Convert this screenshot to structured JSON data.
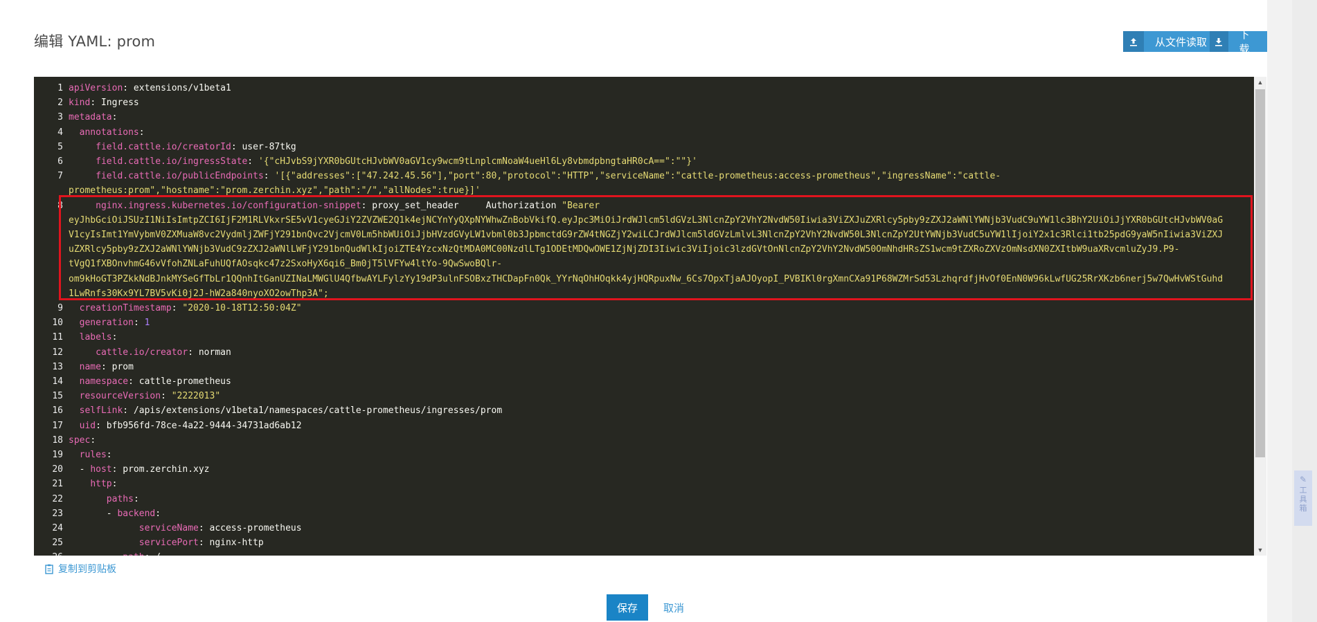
{
  "dialog": {
    "title": "编辑 YAML: prom",
    "read_from_file": "从文件读取",
    "download": "下载",
    "copy_to_clipboard": "复制到剪贴板",
    "save": "保存",
    "cancel": "取消"
  },
  "floating_tab": {
    "label": "工具箱"
  },
  "lines": [
    {
      "n": "1",
      "html": "<span class=\"k\">apiVersion</span>: extensions/v1beta1"
    },
    {
      "n": "2",
      "html": "<span class=\"k\">kind</span>: Ingress"
    },
    {
      "n": "3",
      "html": "<span class=\"k\">metadata</span>:"
    },
    {
      "n": "4",
      "html": "  <span class=\"k\">annotations</span>:"
    },
    {
      "n": "5",
      "html": "     <span class=\"k\">field.cattle.io/creatorId</span>: user-87tkg"
    },
    {
      "n": "6",
      "html": "     <span class=\"k\">field.cattle.io/ingressState</span>: <span class=\"s\">'{\"cHJvbS9jYXR0bGUtcHJvbWV0aGV1cy9wcm9tLnplcmNoaW4ueHl6Ly8vbmdpbngtaHR0cA==\":\"\"}'</span>"
    },
    {
      "n": "7",
      "html": "     <span class=\"k\">field.cattle.io/publicEndpoints</span>: <span class=\"s\">'[{\"addresses\":[\"47.242.45.56\"],\"port\":80,\"protocol\":\"HTTP\",\"serviceName\":\"cattle-prometheus:access-prometheus\",\"ingressName\":\"cattle-</span>"
    },
    {
      "n": "",
      "html": "<span class=\"s\">prometheus:prom\",\"hostname\":\"prom.zerchin.xyz\",\"path\":\"/\",\"allNodes\":true}]'</span>"
    },
    {
      "n": "8",
      "html": "     <span class=\"k\">nginx.ingress.kubernetes.io/configuration-snippet</span>: proxy_set_header     Authorization <span class=\"s\">\"Bearer</span>"
    },
    {
      "n": "",
      "html": "<span class=\"s\">eyJhbGciOiJSUzI1NiIsImtpZCI6IjF2M1RLVkxrSE5vV1cyeGJiY2ZVZWE2Q1k4ejNCYnYyQXpNYWhwZnBobVkifQ.eyJpc3MiOiJrdWJlcm5ldGVzL3NlcnZpY2VhY2NvdW50Iiwia3ViZXJuZXRlcy5pby9zZXJ2aWNlYWNjb3VudC9uYW1lc3BhY2UiOiJjYXR0bGUtcHJvbWV0aG</span>"
    },
    {
      "n": "",
      "html": "<span class=\"s\">V1cyIsImt1YmVybmV0ZXMuaW8vc2VydmljZWFjY291bnQvc2VjcmV0Lm5hbWUiOiJjbHVzdGVyLW1vbml0b3JpbmctdG9rZW4tNGZjY2wiLCJrdWJlcm5ldGVzLmlvL3NlcnZpY2VhY2NvdW50L3NlcnZpY2UtYWNjb3VudC5uYW1lIjoiY2x1c3Rlci1tb25pdG9yaW5nIiwia3ViZXJ</span>"
    },
    {
      "n": "",
      "html": "<span class=\"s\">uZXRlcy5pby9zZXJ2aWNlYWNjb3VudC9zZXJ2aWNlLWFjY291bnQudWlkIjoiZTE4YzcxNzQtMDA0MC00NzdlLTg1ODEtMDQwOWE1ZjNjZDI3Iiwic3ViIjoic3lzdGVtOnNlcnZpY2VhY2NvdW50OmNhdHRsZS1wcm9tZXRoZXVzOmNsdXN0ZXItbW9uaXRvcmluZyJ9.P9-</span>"
    },
    {
      "n": "",
      "html": "<span class=\"s\">tVgQ1fXBOnvhmG46vVfohZNLaFuhUQfAOsqkc47z2SxoHyX6qi6_Bm0jT5lVFYw4ltYo-9QwSwoBQlr-</span>"
    },
    {
      "n": "",
      "html": "<span class=\"s\">om9kHoGT3PZkkNdBJnkMYSeGfTbLr1QQnhItGanUZINaLMWGlU4QfbwAYLFylzYy19dP3ulnFSOBxzTHCDapFn0Qk_YYrNqOhHOqkk4yjHQRpuxNw_6Cs7OpxTjaAJOyopI_PVBIKl0rgXmnCXa91P68WZMrSd53LzhqrdfjHvOf0EnN0W96kLwfUG25RrXKzb6nerj5w7QwHvWStGuhd</span>"
    },
    {
      "n": "",
      "html": "<span class=\"s\">1LwRnfs30Kx9YL7BV5vKi0j2J-hW2a840nyoXO2owThp3A\";</span>"
    },
    {
      "n": "9",
      "html": "  <span class=\"k\">creationTimestamp</span>: <span class=\"s\">\"2020-10-18T12:50:04Z\"</span>"
    },
    {
      "n": "10",
      "html": "  <span class=\"k\">generation</span>: <span class=\"n\">1</span>"
    },
    {
      "n": "11",
      "html": "  <span class=\"k\">labels</span>:"
    },
    {
      "n": "12",
      "html": "     <span class=\"k\">cattle.io/creator</span>: norman"
    },
    {
      "n": "13",
      "html": "  <span class=\"k\">name</span>: prom"
    },
    {
      "n": "14",
      "html": "  <span class=\"k\">namespace</span>: cattle-prometheus"
    },
    {
      "n": "15",
      "html": "  <span class=\"k\">resourceVersion</span>: <span class=\"s\">\"2222013\"</span>"
    },
    {
      "n": "16",
      "html": "  <span class=\"k\">selfLink</span>: /apis/extensions/v1beta1/namespaces/cattle-prometheus/ingresses/prom"
    },
    {
      "n": "17",
      "html": "  <span class=\"k\">uid</span>: bfb956fd-78ce-4a22-9444-34731ad6ab12"
    },
    {
      "n": "18",
      "html": "<span class=\"k\">spec</span>:"
    },
    {
      "n": "19",
      "html": "  <span class=\"k\">rules</span>:"
    },
    {
      "n": "20",
      "html": "  - <span class=\"k\">host</span>: prom.zerchin.xyz"
    },
    {
      "n": "21",
      "html": "    <span class=\"k\">http</span>:"
    },
    {
      "n": "22",
      "html": "       <span class=\"k\">paths</span>:"
    },
    {
      "n": "23",
      "html": "       - <span class=\"k\">backend</span>:"
    },
    {
      "n": "24",
      "html": "             <span class=\"k\">serviceName</span>: access-prometheus"
    },
    {
      "n": "25",
      "html": "             <span class=\"k\">servicePort</span>: nginx-http"
    },
    {
      "n": "26",
      "html": "          <span class=\"k\">path</span>: /"
    }
  ],
  "colors": {
    "accent": "#3d98d3",
    "editor_bg": "#272822",
    "highlight_border": "#e0141e"
  }
}
